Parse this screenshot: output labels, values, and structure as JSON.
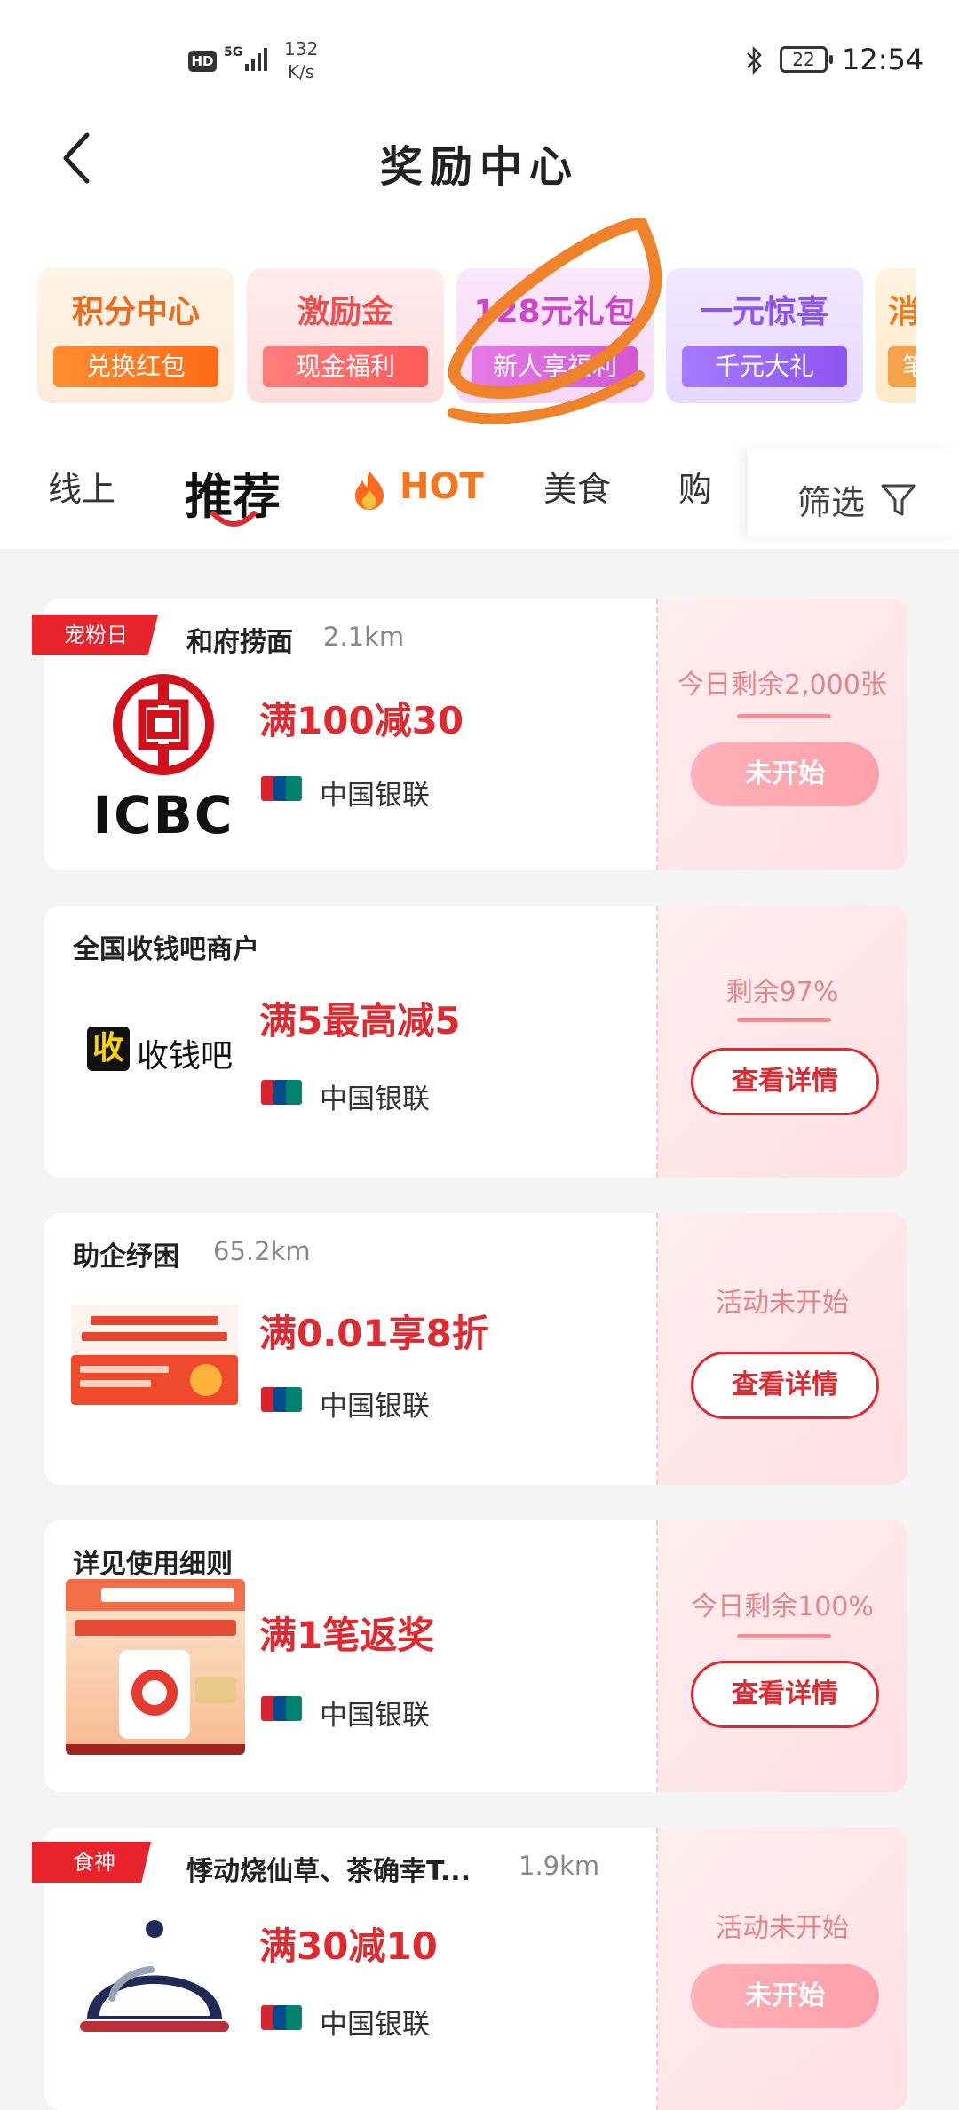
{
  "status_bar": {
    "hd": "HD",
    "network": "5G",
    "speed_value": "132",
    "speed_unit": "K/s",
    "battery": "22",
    "time": "12:54"
  },
  "header": {
    "title": "奖励中心"
  },
  "promos": [
    {
      "title": "积分中心",
      "button": "兑换红包"
    },
    {
      "title": "激励金",
      "button": "现金福利"
    },
    {
      "title": "128元礼包",
      "button": "新人享福利"
    },
    {
      "title": "一元惊喜",
      "button": "千元大礼"
    },
    {
      "title": "消",
      "button": "笔"
    }
  ],
  "tabs": {
    "online": "线上",
    "recommended": "推荐",
    "hot": "HOT",
    "food": "美食",
    "shopping": "购"
  },
  "filter": {
    "label": "筛选"
  },
  "cards": [
    {
      "tag": "宠粉日",
      "merchant": "和府捞面",
      "distance": "2.1km",
      "logo_text": "ICBC",
      "deal": "满100减30",
      "network": "中国银联",
      "stock": "今日剩余2,000张",
      "button": "未开始"
    },
    {
      "merchant": "全国收钱吧商户",
      "logo_icon": "收",
      "logo_text": "收钱吧",
      "deal": "满5最高减5",
      "network": "中国银联",
      "stock": "剩余97%",
      "button": "查看详情"
    },
    {
      "merchant": "助企纾困",
      "distance": "65.2km",
      "deal": "满0.01享8折",
      "network": "中国银联",
      "stock": "活动未开始",
      "button": "查看详情"
    },
    {
      "merchant": "详见使用细则",
      "deal": "满1笔返奖",
      "network": "中国银联",
      "stock": "今日剩余100%",
      "button": "查看详情"
    },
    {
      "tag": "食神",
      "merchant": "悸动烧仙草、茶确幸T...",
      "distance": "1.9km",
      "deal": "满30减10",
      "network": "中国银联",
      "stock": "活动未开始",
      "button": "未开始"
    }
  ],
  "colors": {
    "accent_red": "#e02a31",
    "annotation_orange": "#f0822a"
  }
}
